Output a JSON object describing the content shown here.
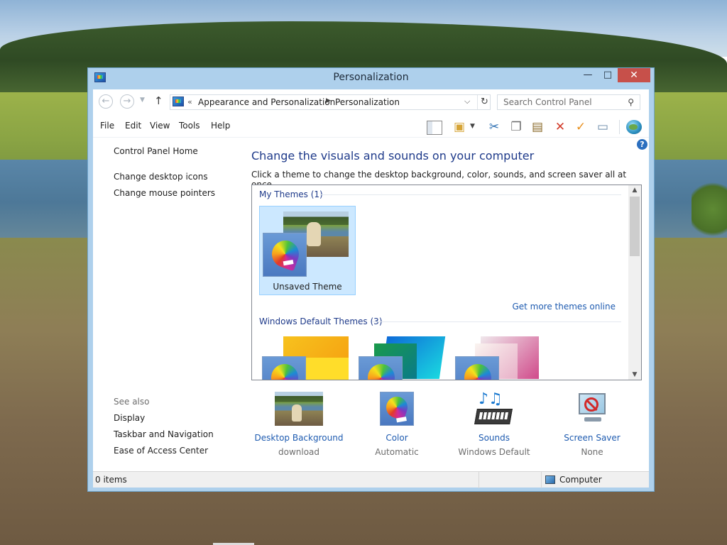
{
  "window": {
    "title": "Personalization",
    "controls": {
      "minimize": "—",
      "maximize": "□",
      "close": "✕"
    }
  },
  "address_bar": {
    "prefix": "«",
    "breadcrumbs": [
      "Appearance and Personalization",
      "Personalization"
    ],
    "search_placeholder": "Search Control Panel"
  },
  "menu": {
    "items": [
      "File",
      "Edit",
      "View",
      "Tools",
      "Help"
    ]
  },
  "toolbar": {
    "icons": [
      "preview-pane-icon",
      "properties-icon",
      "cut-icon",
      "copy-icon",
      "paste-icon",
      "delete-icon",
      "apply-icon",
      "rename-icon",
      "globe-icon"
    ]
  },
  "sidebar": {
    "home": "Control Panel Home",
    "links": [
      "Change desktop icons",
      "Change mouse pointers"
    ],
    "see_also_label": "See also",
    "see_also": [
      "Display",
      "Taskbar and Navigation",
      "Ease of Access Center"
    ]
  },
  "main": {
    "title": "Change the visuals and sounds on your computer",
    "subtitle": "Click a theme to change the desktop background, color, sounds, and screen saver all at once.",
    "my_themes_header": "My Themes (1)",
    "unsaved_theme_label": "Unsaved Theme",
    "more_themes_link": "Get more themes online",
    "default_themes_header": "Windows Default Themes (3)"
  },
  "customizations": [
    {
      "label": "Desktop Background",
      "value": "download"
    },
    {
      "label": "Color",
      "value": "Automatic"
    },
    {
      "label": "Sounds",
      "value": "Windows Default"
    },
    {
      "label": "Screen Saver",
      "value": "None"
    }
  ],
  "status_bar": {
    "items": "0 items",
    "location": "Computer"
  },
  "colors": {
    "title_color": "#1e3a8a",
    "link_color": "#1e5bb0",
    "selection": "#cce8ff",
    "close_button": "#c7504a",
    "window_frame": "#aed0ec"
  }
}
